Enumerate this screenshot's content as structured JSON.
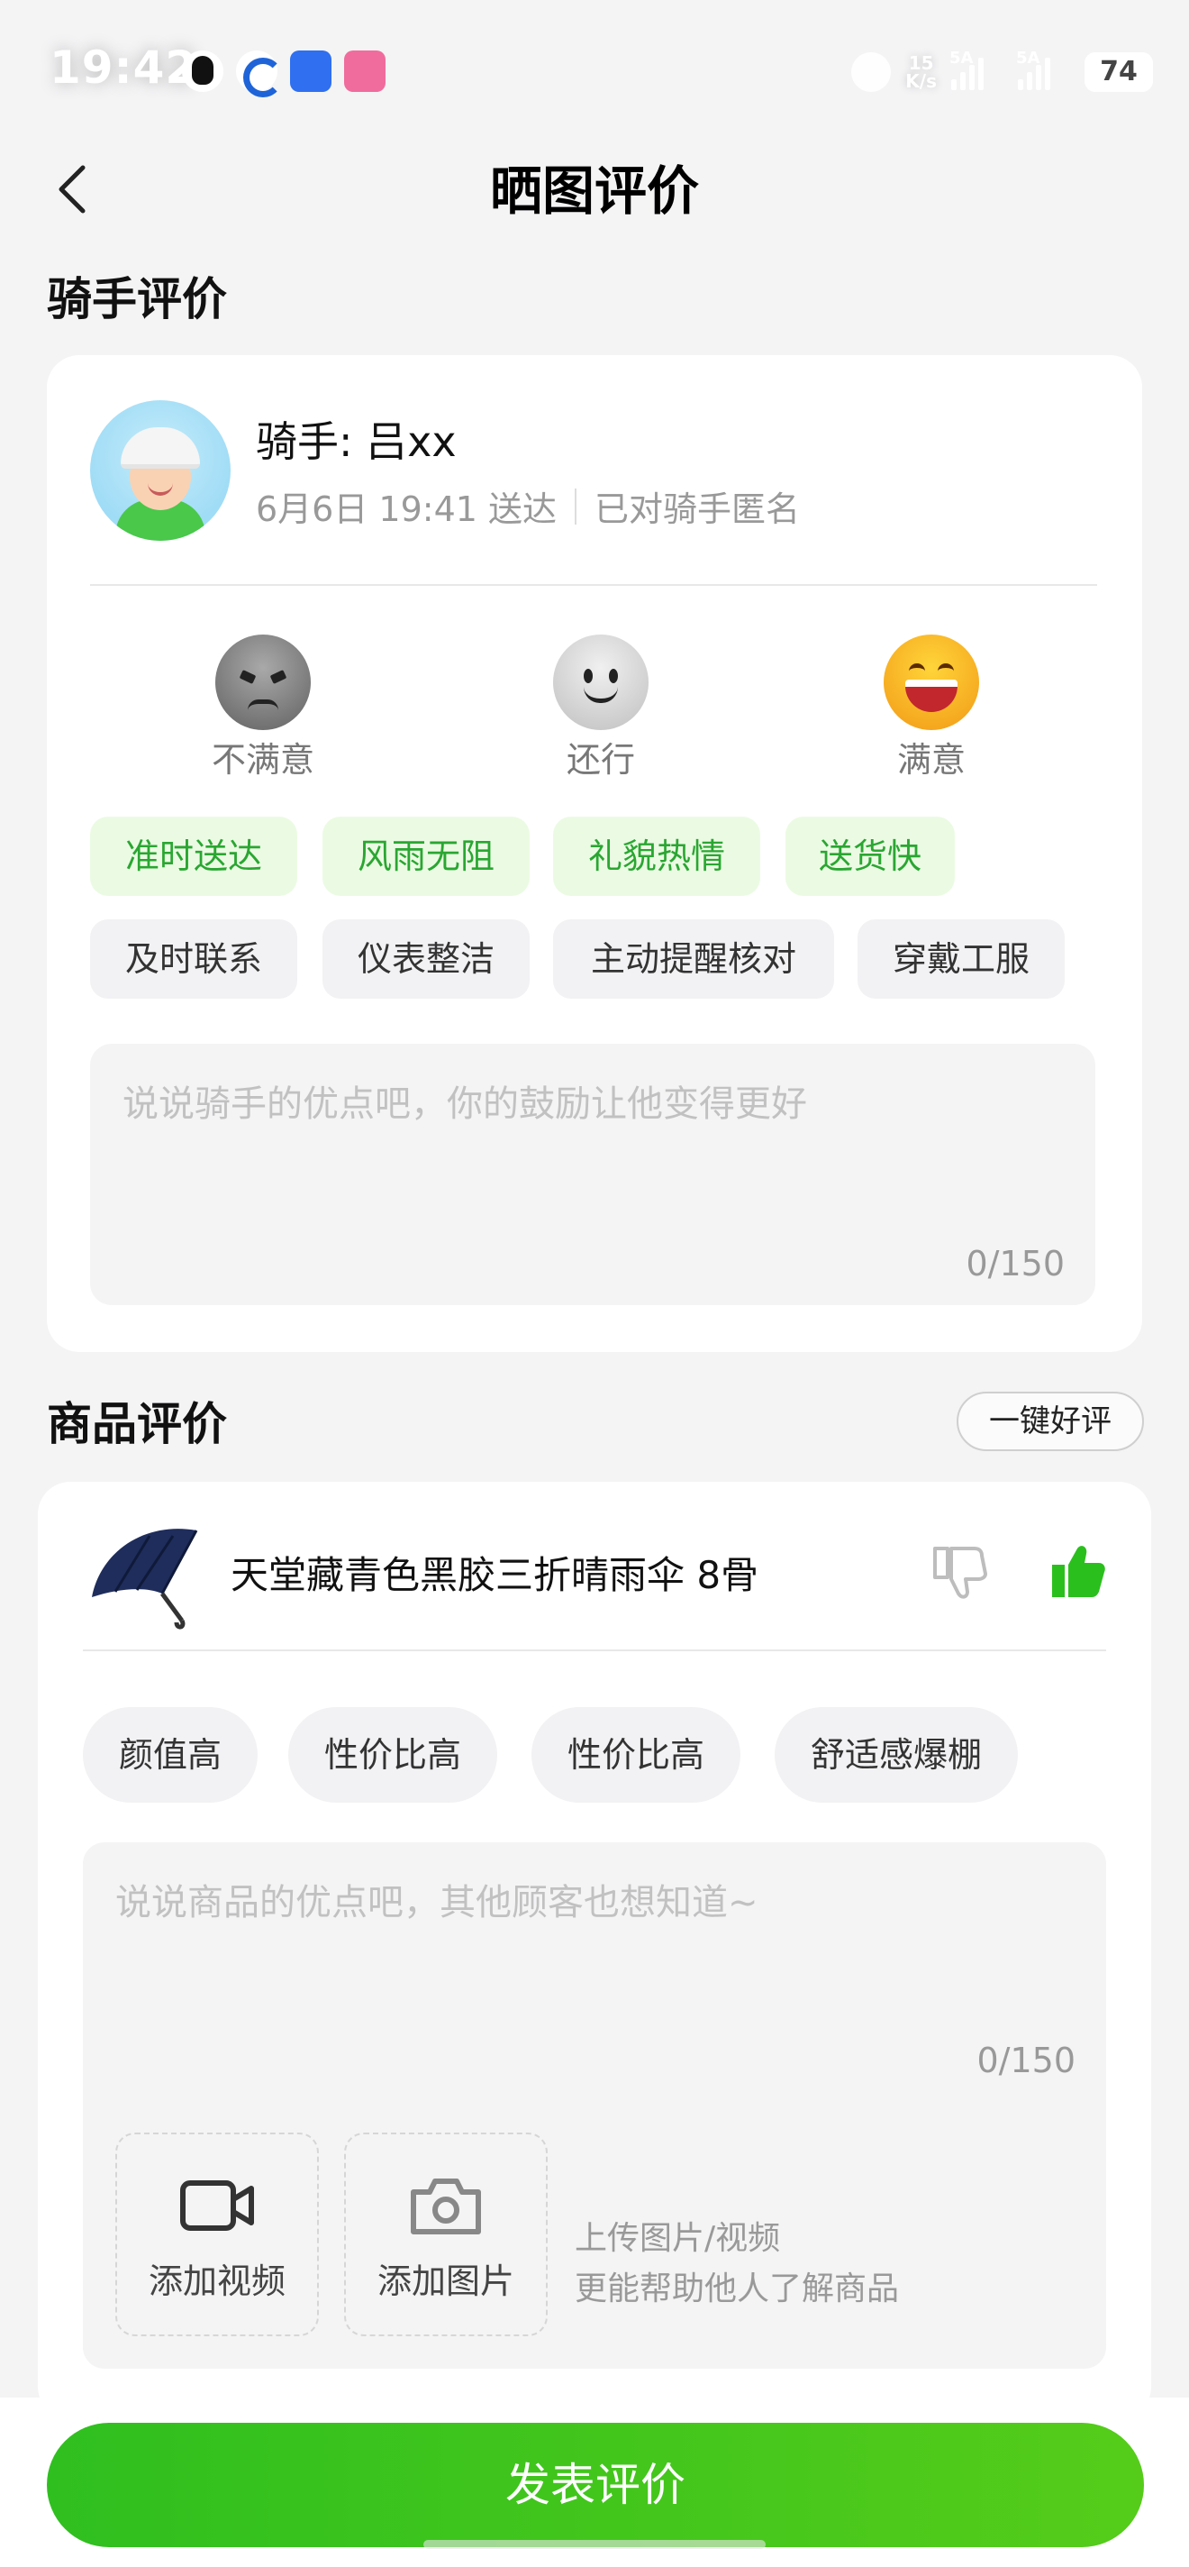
{
  "status_bar": {
    "time": "19:42",
    "net_rate_top": "15",
    "net_rate_bottom": "K/s",
    "signal1_label": "5A",
    "signal2_label": "5A",
    "battery": "74"
  },
  "header": {
    "title": "晒图评价"
  },
  "rider_section": {
    "title": "骑手评价",
    "rider_name": "骑手: 吕xx",
    "delivered": "6月6日 19:41 送达",
    "anonymous": "已对骑手匿名",
    "ratings": [
      {
        "label": "不满意",
        "icon": "angry-face-icon"
      },
      {
        "label": "还行",
        "icon": "neutral-face-icon"
      },
      {
        "label": "满意",
        "icon": "happy-face-icon",
        "selected": true
      }
    ],
    "tags_selected": [
      "准时送达",
      "风雨无阻",
      "礼貌热情",
      "送货快"
    ],
    "tags": [
      "及时联系",
      "仪表整洁",
      "主动提醒核对",
      "穿戴工服"
    ],
    "placeholder": "说说骑手的优点吧，你的鼓励让他变得更好",
    "count": "0/150"
  },
  "product_section": {
    "title": "商品评价",
    "quick_good_review": "一键好评",
    "product_name": "天堂藏青色黑胶三折晴雨伞 8骨",
    "tags": [
      "颜值高",
      "性价比高",
      "性价比高",
      "舒适感爆棚"
    ],
    "placeholder": "说说商品的优点吧，其他顾客也想知道~",
    "count": "0/150",
    "add_video": "添加视频",
    "add_photo": "添加图片",
    "upload_hint_1": "上传图片/视频",
    "upload_hint_2": "更能帮助他人了解商品"
  },
  "submit_label": "发表评价",
  "colors": {
    "accent": "#2fbf1f",
    "tag_green_bg": "#ebfbe3",
    "tag_green_text": "#2aa632"
  }
}
